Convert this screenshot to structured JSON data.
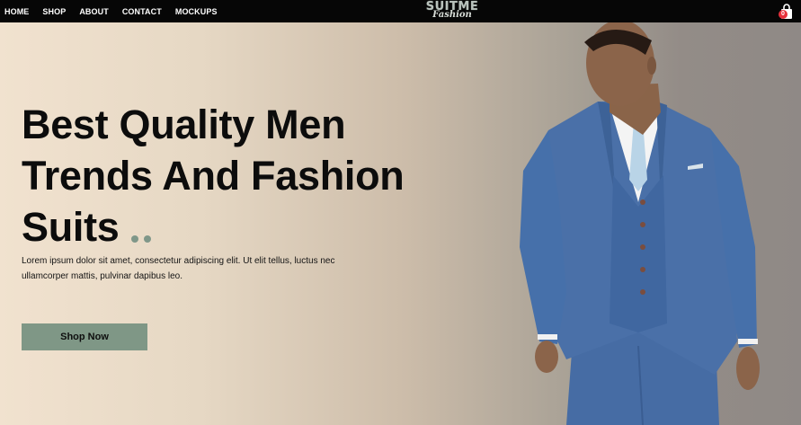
{
  "nav": {
    "links": [
      "HOME",
      "SHOP",
      "ABOUT",
      "CONTACT",
      "MOCKUPS"
    ]
  },
  "logo": {
    "main": "SUITME",
    "sub": "Fashion"
  },
  "cart": {
    "count": "0",
    "icon": "shopping-bag-icon"
  },
  "hero": {
    "title_lines": [
      "Best Quality Men",
      "Trends And Fashion",
      "Suits"
    ],
    "description_lines": [
      "Lorem ipsum dolor sit amet, consectetur adipiscing elit. Ut elit tellus, luctus nec",
      "ullamcorper mattis, pulvinar dapibus leo."
    ],
    "button_label": "Shop Now"
  },
  "colors": {
    "nav_bg": "#060606",
    "accent": "#7f9786",
    "badge": "#e6303b",
    "suit": "#4a70a8"
  }
}
